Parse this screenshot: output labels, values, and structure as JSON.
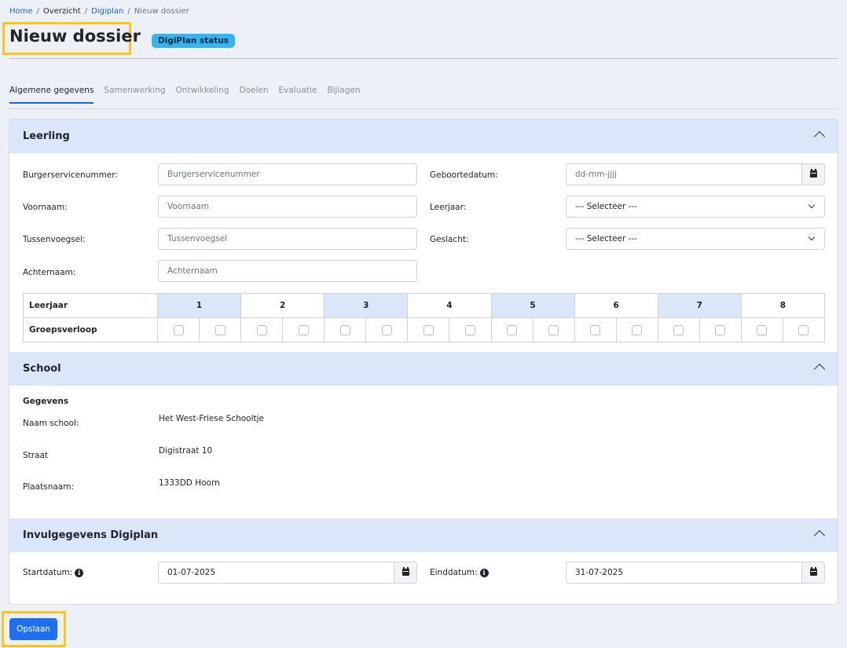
{
  "breadcrumb": {
    "home": "Home",
    "overview": "Overzicht",
    "digiplan": "Digiplan",
    "current": "Nieuw dossier",
    "separator": "/"
  },
  "header": {
    "title": "Nieuw dossier",
    "status_badge": "DigiPlan status"
  },
  "tabs": [
    {
      "label": "Algemene gegevens",
      "active": true
    },
    {
      "label": "Samenwerking",
      "active": false
    },
    {
      "label": "Ontwikkeling",
      "active": false
    },
    {
      "label": "Doelen",
      "active": false
    },
    {
      "label": "Evaluatie",
      "active": false
    },
    {
      "label": "Bijlagen",
      "active": false
    }
  ],
  "leerling": {
    "title": "Leerling",
    "bsn": {
      "label": "Burgerservicenummer:",
      "placeholder": "Burgerservicenummer"
    },
    "voornaam": {
      "label": "Voornaam:",
      "placeholder": "Voornaam"
    },
    "tussenvoegsel": {
      "label": "Tussenvoegsel:",
      "placeholder": "Tussenvoegsel"
    },
    "achternaam": {
      "label": "Achternaam:",
      "placeholder": "Achternaam"
    },
    "geboortedatum": {
      "label": "Geboortedatum:",
      "placeholder": "dd-mm-jjjj"
    },
    "leerjaar": {
      "label": "Leerjaar:",
      "value": "--- Selecteer ---"
    },
    "geslacht": {
      "label": "Geslacht:",
      "value": "--- Selecteer ---"
    },
    "grid": {
      "row1_label": "Leerjaar",
      "row2_label": "Groepsverloop",
      "years": [
        "1",
        "2",
        "3",
        "4",
        "5",
        "6",
        "7",
        "8"
      ]
    }
  },
  "school": {
    "title": "School",
    "subtitle": "Gegevens",
    "naam": {
      "label": "Naam school:",
      "value": "Het West-Friese Schooltje"
    },
    "straat": {
      "label": "Straat",
      "value": "Digistraat 10"
    },
    "plaats": {
      "label": "Plaatsnaam:",
      "value": "1333DD Hoorn"
    }
  },
  "invul": {
    "title": "Invulgegevens Digiplan",
    "start": {
      "label": "Startdatum:",
      "value": "01-07-2025"
    },
    "eind": {
      "label": "Einddatum:",
      "value": "31-07-2025"
    },
    "info_glyph": "i"
  },
  "footer": {
    "save_label": "Opslaan"
  },
  "colors": {
    "accent": "#1e6ff2",
    "highlight": "#ffc61a",
    "section_header": "#dce6fb",
    "badge": "#34b5f0"
  }
}
